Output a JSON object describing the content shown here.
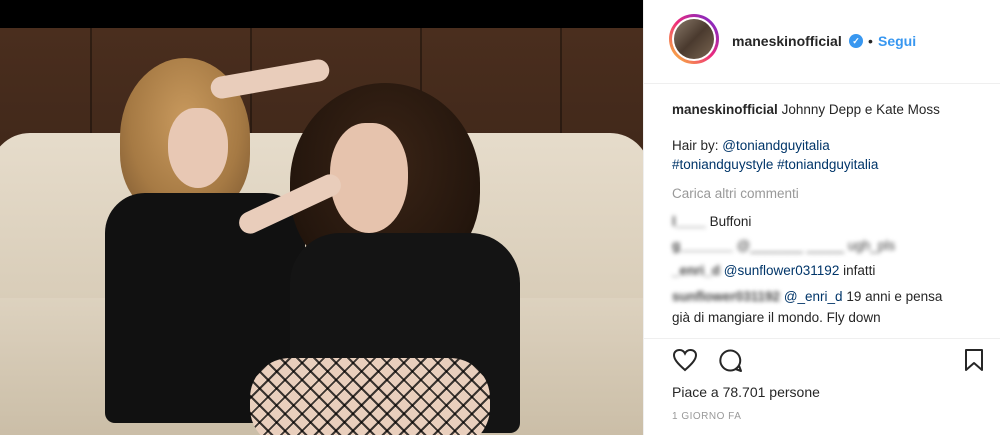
{
  "post": {
    "username": "maneskinofficial",
    "separator": "•",
    "follow_label": "Segui",
    "caption_text": "Johnny Depp e Kate Moss",
    "hair_by_label": "Hair by:",
    "hair_by_mention": "@toniandguyitalia",
    "hashtags": "#toniandguystyle #toniandguyitalia",
    "load_more": "Carica altri commenti"
  },
  "comments": [
    {
      "user": "l____",
      "text": "Buffoni"
    },
    {
      "user": "g_______",
      "text": "@_______ _____ ugh_pls"
    },
    {
      "user": "_enri_d",
      "mention": "@sunflower031192",
      "text": "infatti"
    },
    {
      "user": "sunflower031192",
      "mention": "@_enri_d",
      "text": "19 anni e pensa",
      "text2": "già di mangiare il mondo. Fly down"
    }
  ],
  "actions": {
    "likes_text": "Piace a 78.701 persone",
    "time_text": "1 GIORNO FA"
  },
  "icons": [
    "heart-icon",
    "comment-icon",
    "bookmark-icon",
    "verified-badge-icon"
  ],
  "colors": {
    "link": "#3897f0",
    "mention": "#003569",
    "muted": "#999999",
    "text": "#262626"
  }
}
